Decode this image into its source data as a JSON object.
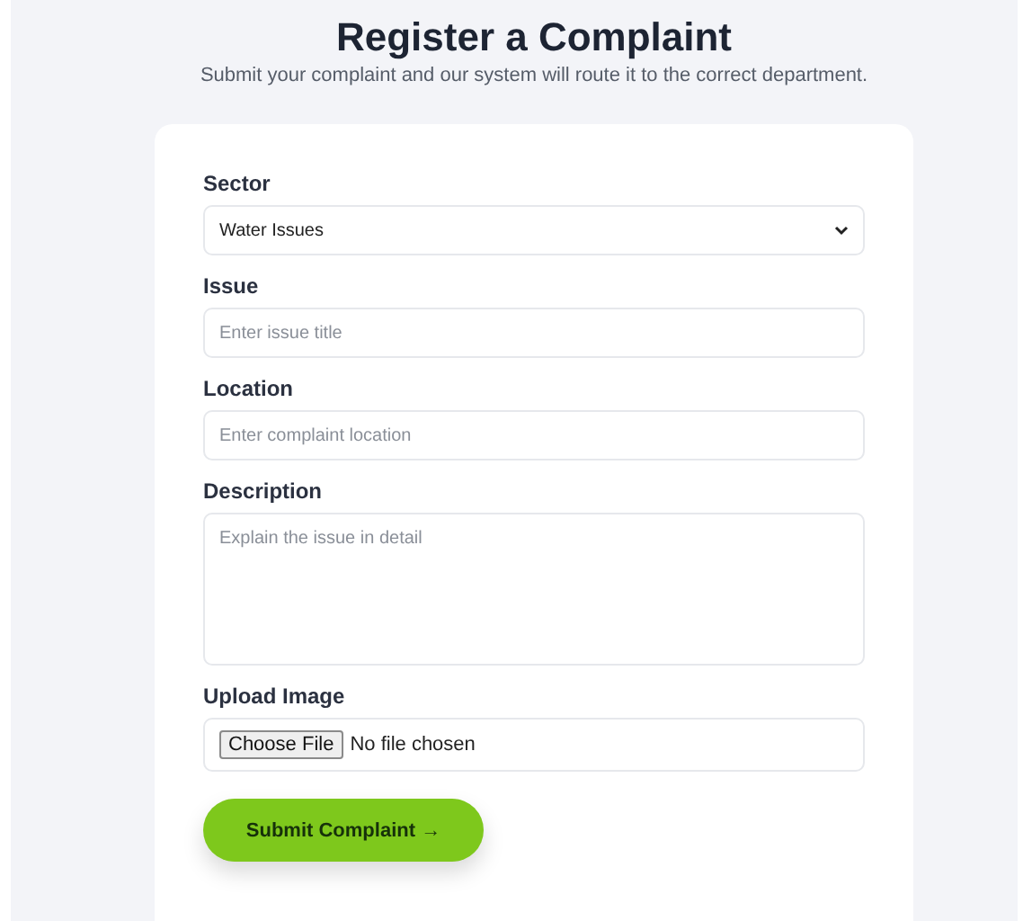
{
  "title": "Register a Complaint",
  "subtitle": "Submit your complaint and our system will route it to the correct department.",
  "fields": [
    {
      "kind": "select",
      "label": "Sector",
      "value": "Water Issues"
    },
    {
      "kind": "text",
      "label": "Issue",
      "placeholder": "Enter issue title"
    },
    {
      "kind": "text",
      "label": "Location",
      "placeholder": "Enter complaint location"
    },
    {
      "kind": "textarea",
      "label": "Description",
      "placeholder": "Explain the issue in detail"
    },
    {
      "kind": "file",
      "label": "Upload Image",
      "button": "Choose File",
      "status": "No file chosen"
    }
  ],
  "submit": "Submit Complaint →"
}
